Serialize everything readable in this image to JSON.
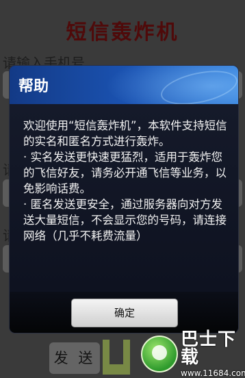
{
  "app": {
    "title": "短信轰炸机",
    "phone_label": "请输入手机号",
    "label2_partial": "请",
    "label3_partial": "请",
    "send_label": "发 送"
  },
  "dialog": {
    "title": "帮助",
    "paragraphs": [
      "欢迎使用“短信轰炸机”，本软件支持短信的实名和匿名方式进行轰炸。",
      "· 实名发送更快速更猛烈，适用于轰炸您的飞信好友，请务必开通飞信等业务，以免影响话费。",
      "· 匿名发送更安全，通过服务器向对方发送大量短信，不会显示您的号码，请连接网络（几乎不耗费流量）"
    ],
    "ok_label": "确定"
  },
  "watermark": {
    "main": "巴士下载",
    "sub": "www.11684.com"
  },
  "colors": {
    "app_title": "#7a1010",
    "dialog_header": "#1b54b4",
    "dialog_body": "#101422"
  }
}
